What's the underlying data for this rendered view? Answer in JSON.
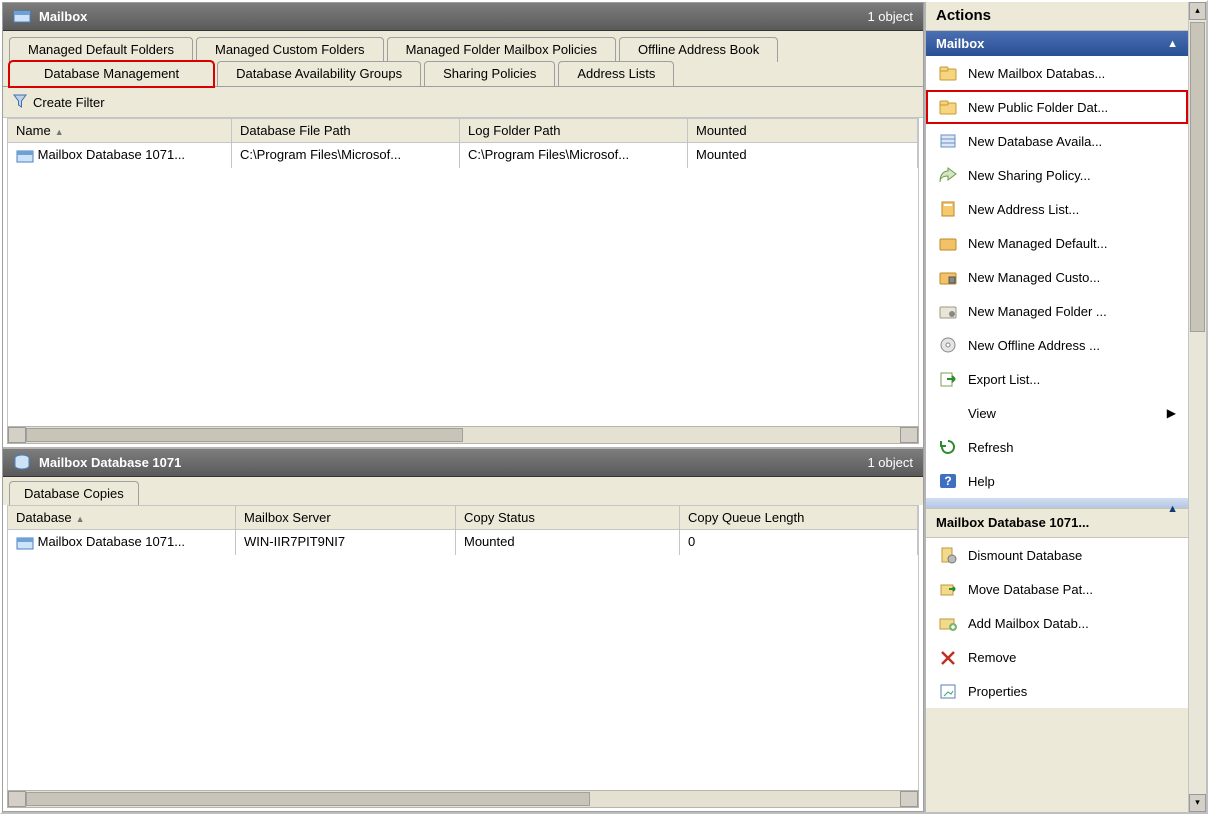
{
  "upper": {
    "title": "Mailbox",
    "count": "1 object",
    "tabs_row1": [
      {
        "label": "Managed Default Folders"
      },
      {
        "label": "Managed Custom Folders"
      },
      {
        "label": "Managed Folder Mailbox Policies"
      },
      {
        "label": "Offline Address Book"
      }
    ],
    "tabs_row2": [
      {
        "label": "Database Management",
        "active": true,
        "highlight": true
      },
      {
        "label": "Database Availability Groups"
      },
      {
        "label": "Sharing Policies"
      },
      {
        "label": "Address Lists"
      }
    ],
    "filter_label": "Create Filter",
    "columns": [
      "Name",
      "Database File Path",
      "Log Folder Path",
      "Mounted"
    ],
    "rows": [
      {
        "name": "Mailbox Database 1071...",
        "path": "C:\\Program Files\\Microsof...",
        "log": "C:\\Program Files\\Microsof...",
        "mounted": "Mounted"
      }
    ]
  },
  "lower": {
    "title": "Mailbox Database 1071",
    "count": "1 object",
    "tabs": [
      {
        "label": "Database Copies"
      }
    ],
    "columns": [
      "Database",
      "Mailbox Server",
      "Copy Status",
      "Copy Queue Length"
    ],
    "rows": [
      {
        "db": "Mailbox Database 1071...",
        "server": "WIN-IIR7PIT9NI7",
        "status": "Mounted",
        "queue": "0"
      }
    ]
  },
  "actions": {
    "title": "Actions",
    "section1_title": "Mailbox",
    "section1_items": [
      {
        "label": "New Mailbox Databas...",
        "icon": "db-folder"
      },
      {
        "label": "New Public Folder Dat...",
        "icon": "folder",
        "highlight": true
      },
      {
        "label": "New Database Availa...",
        "icon": "db-group"
      },
      {
        "label": "New Sharing Policy...",
        "icon": "share"
      },
      {
        "label": "New Address List...",
        "icon": "book"
      },
      {
        "label": "New Managed Default...",
        "icon": "folder2"
      },
      {
        "label": "New Managed Custo...",
        "icon": "folder-lock"
      },
      {
        "label": "New Managed Folder ...",
        "icon": "folder-gear"
      },
      {
        "label": "New Offline Address ...",
        "icon": "disc"
      },
      {
        "label": "Export List...",
        "icon": "export"
      },
      {
        "label": "View",
        "icon": "",
        "submenu": true
      },
      {
        "label": "Refresh",
        "icon": "refresh"
      },
      {
        "label": "Help",
        "icon": "help"
      }
    ],
    "section2_title": "Mailbox Database 1071...",
    "section2_items": [
      {
        "label": "Dismount Database",
        "icon": "dismount"
      },
      {
        "label": "Move Database Pat...",
        "icon": "move"
      },
      {
        "label": "Add Mailbox Datab...",
        "icon": "add-db"
      },
      {
        "label": "Remove",
        "icon": "remove"
      },
      {
        "label": "Properties",
        "icon": "properties"
      }
    ]
  }
}
